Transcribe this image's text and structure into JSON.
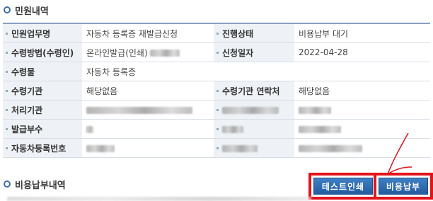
{
  "sections": {
    "complaint_title": "민원내역",
    "fee_title": "비용납부내역"
  },
  "rows": {
    "r1": {
      "label1": "민원업무명",
      "value1": "자동차 등록증 재발급신청",
      "label2": "진행상태",
      "value2": "비용납부 대기"
    },
    "r2": {
      "label1": "수령방법(수령인)",
      "value1": "온라인발급(인쇄)",
      "label2": "신청일자",
      "value2": "2022-04-28"
    },
    "r3": {
      "label1": "수령물",
      "value1": "자동차 등록증"
    },
    "r4": {
      "label1": "수령기관",
      "value1": "해당없음",
      "label2": "수령기관 연락처",
      "value2": "해당없음"
    },
    "r5": {
      "label1": "처리기관"
    },
    "r6": {
      "label1": "발급부수"
    },
    "r7": {
      "label1": "자동차등록번호"
    }
  },
  "buttons": {
    "test_print": "테스트인쇄",
    "pay_fee": "비용납부"
  },
  "colors": {
    "highlight": "#e3141b",
    "button": "#2f6db4",
    "header_bg": "#eef2f6"
  }
}
